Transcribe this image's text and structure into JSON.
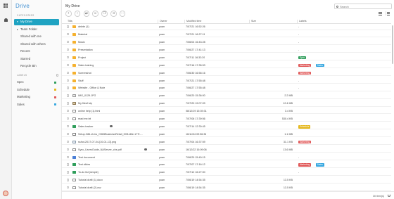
{
  "app": {
    "logo": "Drive"
  },
  "rail": {
    "icons": [
      "apps-grid-icon",
      "notifications-bell-icon",
      "user-avatar-icon"
    ]
  },
  "sidebar": {
    "categories_title": "CATEGORIES",
    "nav": [
      {
        "label": "My Drive",
        "caret": "▾",
        "active": true
      },
      {
        "label": "Team Folder",
        "caret": "▸",
        "active": false
      },
      {
        "label": "Shared with me",
        "caret": "",
        "active": false
      },
      {
        "label": "Shared with others",
        "caret": "",
        "active": false
      },
      {
        "label": "Recent",
        "caret": "",
        "active": false
      },
      {
        "label": "Starred",
        "caret": "",
        "active": false
      },
      {
        "label": "Recycle Bin",
        "caret": "",
        "active": false
      }
    ],
    "labels_title": "LABELS",
    "labels": [
      {
        "label": "Spec",
        "color": "#2f9e5b"
      },
      {
        "label": "Schedule",
        "color": "#e5b81e"
      },
      {
        "label": "Marketing",
        "color": "#e05757"
      },
      {
        "label": "Sales",
        "color": "#39a8e0"
      }
    ]
  },
  "header": {
    "title": "My Drive",
    "search_placeholder": "Search"
  },
  "toolbar": {
    "buttons": [
      {
        "name": "add-button",
        "glyph": "+"
      },
      {
        "name": "upload-button",
        "glyph": "↑"
      },
      {
        "name": "share-button",
        "glyph": "⇄"
      },
      {
        "name": "link-button",
        "glyph": "∞"
      },
      {
        "name": "copy-button",
        "glyph": "❐"
      },
      {
        "name": "move-button",
        "glyph": "⇥"
      },
      {
        "name": "more-button",
        "glyph": "⋯"
      }
    ]
  },
  "columns": {
    "name": "Title",
    "owner": "Owner",
    "modified": "Modified time",
    "size": "Size",
    "labels": "Labels"
  },
  "label_colors": {
    "Spec": "#2f9e5b",
    "Schedule": "#e5b81e",
    "Marketing": "#e05757",
    "Sales": "#39a8e0"
  },
  "files": [
    {
      "name": "delete (1)",
      "icon": "folder",
      "owner": "yuan",
      "modified": "7/07/21 16:52:26",
      "size": "-",
      "labels": []
    },
    {
      "name": "Material",
      "icon": "folder",
      "owner": "yuan",
      "modified": "7/07/21 16:27:11",
      "size": "-",
      "labels": []
    },
    {
      "name": "Music",
      "icon": "folder",
      "owner": "yuan",
      "modified": "7/06/04 16:43:28",
      "size": "-",
      "labels": []
    },
    {
      "name": "Presentation",
      "icon": "folder",
      "owner": "yuan",
      "modified": "7/06/27 17:41:13",
      "size": "-",
      "labels": []
    },
    {
      "name": "Project",
      "icon": "folder",
      "owner": "yuan",
      "modified": "7/07/11 16:33:39",
      "size": "-",
      "labels": [
        "Spec"
      ]
    },
    {
      "name": "Sales training",
      "icon": "folder",
      "owner": "yuan",
      "modified": "7/07/16 17:35:53",
      "size": "-",
      "labels": [
        "Marketing",
        "Sales"
      ]
    },
    {
      "name": "Screenshot",
      "icon": "folder",
      "owner": "yuan",
      "modified": "7/06/30 16:56:16",
      "size": "-",
      "labels": [
        "Marketing"
      ]
    },
    {
      "name": "Stuff",
      "icon": "folder",
      "owner": "yuan",
      "modified": "7/07/21 17:55:48",
      "size": "-",
      "labels": []
    },
    {
      "name": "Website - Office & Note",
      "icon": "folder",
      "owner": "yuan",
      "modified": "7/06/27 17:55:48",
      "size": "-",
      "labels": []
    },
    {
      "name": "IMG_0129.JPG",
      "icon": "image",
      "owner": "yuan",
      "modified": "7/06/20 15:36:00",
      "size": "2.2 MB",
      "labels": []
    },
    {
      "name": "My files2.zip",
      "icon": "archive",
      "owner": "yuan",
      "modified": "7/07/20 19:07:09",
      "size": "12.4 MB",
      "labels": []
    },
    {
      "name": "online help (1).html",
      "icon": "html",
      "owner": "yuan",
      "modified": "08/12/19 15:39:31",
      "size": "3.4 KB",
      "labels": []
    },
    {
      "name": "read me.txt",
      "icon": "text",
      "owner": "yuan",
      "modified": "7/07/06 17:39:56",
      "size": "530.4 KB",
      "labels": []
    },
    {
      "name": "Sales tracker",
      "icon": "sheet",
      "owner": "yuan",
      "modified": "7/07/14 12:30:45",
      "size": "-",
      "labels": [
        "Schedule"
      ],
      "shared": true
    },
    {
      "name": "Setup.X86.zh-tw_O365BusinessRetail_00f1e6fe-177f-...",
      "icon": "exe",
      "owner": "yuan",
      "modified": "16/11/04 09:56:36",
      "size": "1.1 MB",
      "labels": []
    },
    {
      "name": "sshot-2017-07-04-[10-01-13].png",
      "icon": "png",
      "owner": "yuan",
      "modified": "7/07/04 16:37:59",
      "size": "31.1 KB",
      "labels": [
        "Marketing"
      ]
    },
    {
      "name": "Sync_UsersGuide_NAServer_chs.pdf",
      "icon": "pdf",
      "owner": "yuan",
      "modified": "16/12/22 16:09:06",
      "size": "13.6 MB",
      "labels": [],
      "shared": true
    },
    {
      "name": "Test document",
      "icon": "doc",
      "owner": "yuan",
      "modified": "7/06/29 15:40:15",
      "size": "-",
      "labels": []
    },
    {
      "name": "Test slides",
      "icon": "sheet",
      "owner": "yuan",
      "modified": "7/07/07 17:16:12",
      "size": "-",
      "labels": [
        "Marketing",
        "Sales"
      ]
    },
    {
      "name": "To-do list (simple)",
      "icon": "sheet",
      "owner": "yuan",
      "modified": "7/07/12 16:27:00",
      "size": "-",
      "labels": []
    },
    {
      "name": "Tutorial draft (1).docx",
      "icon": "word",
      "owner": "yuan",
      "modified": "7/06/19 14:54:35",
      "size": "13.5 KB",
      "labels": []
    },
    {
      "name": "Tutorial draft (2).csv",
      "icon": "csv",
      "owner": "yuan",
      "modified": "7/06/19 14:54:35",
      "size": "13.5 KB",
      "labels": []
    }
  ],
  "footer": {
    "count": "30 item(s)"
  }
}
